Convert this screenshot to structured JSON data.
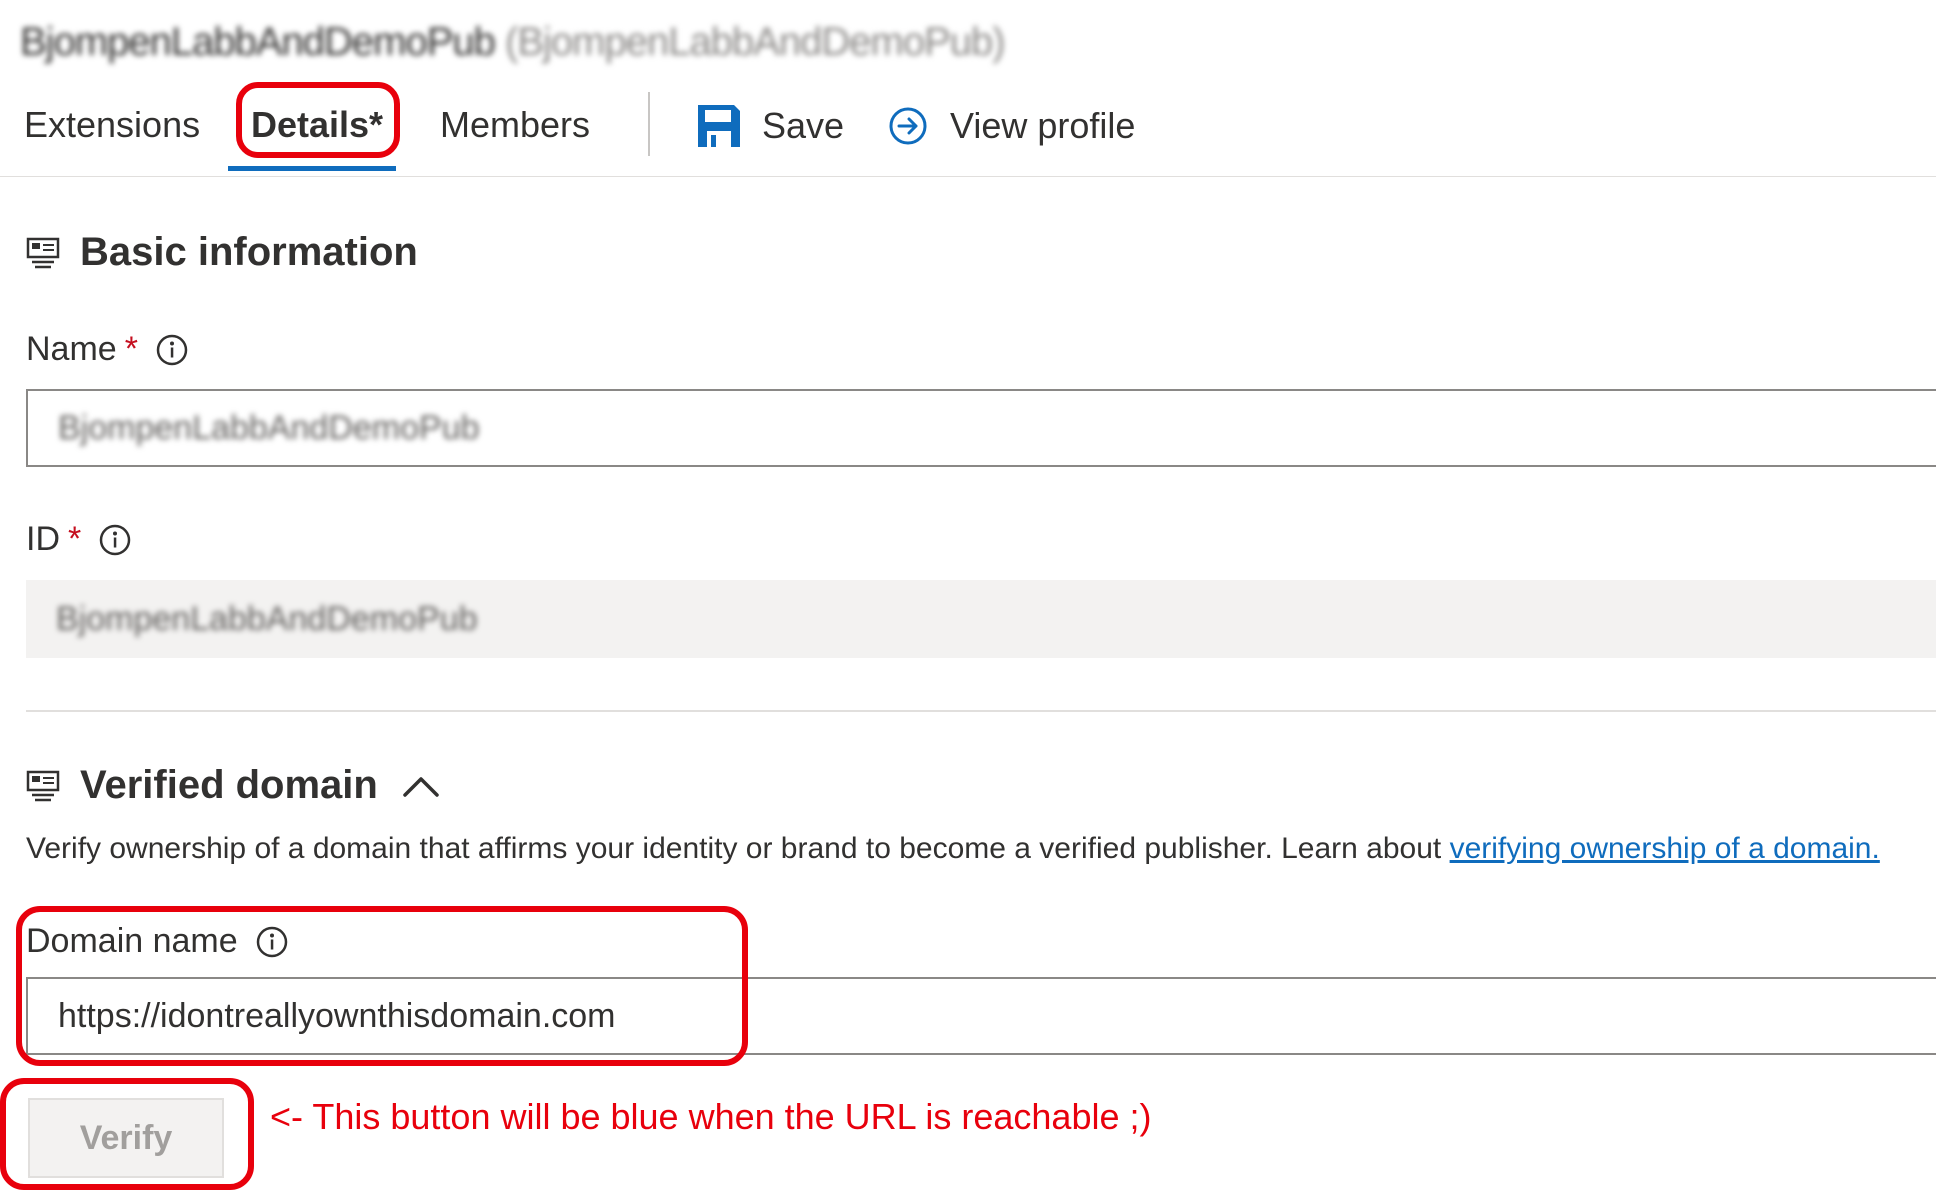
{
  "header": {
    "title": "BjompenLabbAndDemoPub",
    "title_secondary": "(BjompenLabbAndDemoPub)"
  },
  "tabs": [
    {
      "label": "Extensions"
    },
    {
      "label": "Details*",
      "active": true
    },
    {
      "label": "Members"
    }
  ],
  "commands": {
    "save_label": "Save",
    "view_profile_label": "View profile"
  },
  "basic_info": {
    "heading": "Basic information",
    "name_label": "Name",
    "name_value": "BjompenLabbAndDemoPub",
    "id_label": "ID",
    "id_value": "BjompenLabbAndDemoPub",
    "required_marker": "*"
  },
  "verified_domain": {
    "heading": "Verified domain",
    "description": "Verify ownership of a domain that affirms your identity or brand to become a verified publisher. Learn about ",
    "link_text": "verifying ownership of a domain.",
    "domain_label": "Domain name",
    "domain_value": "https://idontreallyownthisdomain.com",
    "verify_label": "Verify"
  },
  "annotation": {
    "text": "<- This button will be blue when the URL is reachable ;)"
  },
  "colors": {
    "accent": "#0f6cbd",
    "annotation": "#e8000c",
    "required": "#c50f1f"
  }
}
